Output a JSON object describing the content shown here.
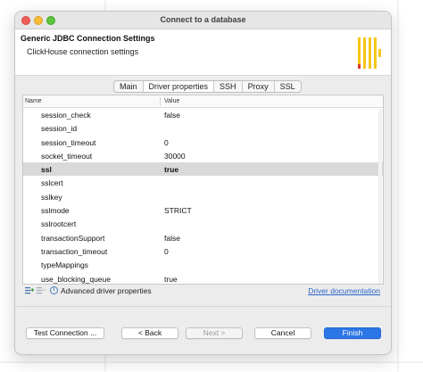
{
  "window": {
    "title": "Connect to a database"
  },
  "header": {
    "title": "Generic JDBC Connection Settings",
    "subtitle": "ClickHouse connection settings"
  },
  "tabs": [
    {
      "label": "Main",
      "active": false
    },
    {
      "label": "Driver properties",
      "active": true
    },
    {
      "label": "SSH",
      "active": false
    },
    {
      "label": "Proxy",
      "active": false
    },
    {
      "label": "SSL",
      "active": false
    }
  ],
  "table": {
    "columns": {
      "name": "Name",
      "value": "Value"
    },
    "rows": [
      {
        "name": "session_check",
        "value": "false"
      },
      {
        "name": "session_id",
        "value": ""
      },
      {
        "name": "session_timeout",
        "value": "0"
      },
      {
        "name": "socket_timeout",
        "value": "30000"
      },
      {
        "name": "ssl",
        "value": "true"
      },
      {
        "name": "sslcert",
        "value": ""
      },
      {
        "name": "sslkey",
        "value": ""
      },
      {
        "name": "sslmode",
        "value": "STRICT"
      },
      {
        "name": "sslrootcert",
        "value": ""
      },
      {
        "name": "transactionSupport",
        "value": "false"
      },
      {
        "name": "transaction_timeout",
        "value": "0"
      },
      {
        "name": "typeMappings",
        "value": ""
      },
      {
        "name": "use_blocking_queue",
        "value": "true"
      }
    ],
    "selected_row": 4
  },
  "bottom_bar": {
    "advanced_label": "Advanced driver properties",
    "doc_link": "Driver documentation"
  },
  "buttons": {
    "test_connection": "Test Connection ...",
    "back": "< Back",
    "next": "Next >",
    "cancel": "Cancel",
    "finish": "Finish"
  },
  "colors": {
    "accent": "#2c76e7",
    "logo_yellow": "#f5c518",
    "logo_red": "#e23a2e"
  },
  "icons": [
    "add-property-icon",
    "remove-property-icon",
    "info-icon"
  ]
}
